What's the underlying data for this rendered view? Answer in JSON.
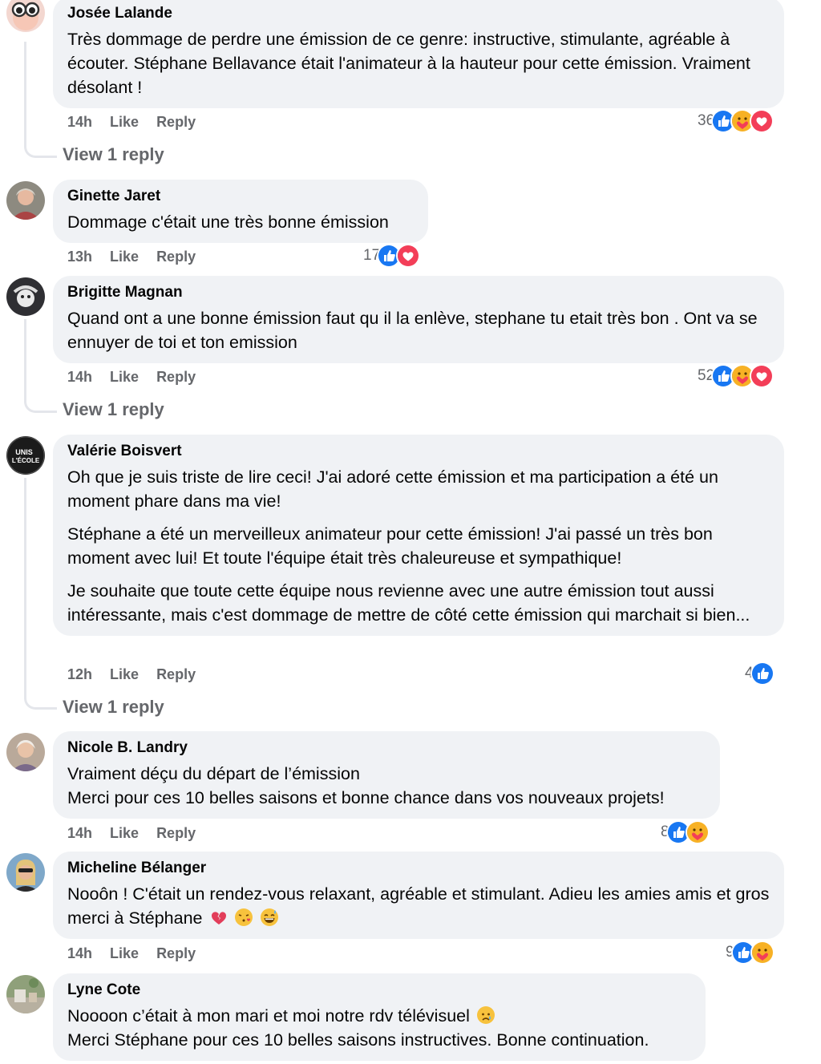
{
  "comments": [
    {
      "author": "Josée Lalande",
      "paragraphs": [
        "Très dommage de perdre une émission de ce genre: instructive, stimulante, agréable à écouter. Stéphane Bellavance était l'animateur à la hauteur pour cette émission. Vraiment désolant !"
      ],
      "time": "14h",
      "like": "Like",
      "reply": "Reply",
      "reaction_count": "36",
      "reactions": [
        "like-icon",
        "care-icon",
        "love-icon"
      ],
      "view_replies": "View 1 reply"
    },
    {
      "author": "Ginette Jaret",
      "paragraphs": [
        "Dommage c'était une très bonne émission"
      ],
      "time": "13h",
      "like": "Like",
      "reply": "Reply",
      "reaction_count": "17",
      "reactions": [
        "like-icon",
        "love-icon"
      ]
    },
    {
      "author": "Brigitte Magnan",
      "paragraphs": [
        "Quand ont a une bonne émission faut qu il la enlève, stephane tu etait très bon . Ont va se ennuyer de toi et ton emission"
      ],
      "time": "14h",
      "like": "Like",
      "reply": "Reply",
      "reaction_count": "52",
      "reactions": [
        "like-icon",
        "care-icon",
        "love-icon"
      ],
      "view_replies": "View 1 reply"
    },
    {
      "author": "Valérie Boisvert",
      "avatar_text": [
        "UNIS",
        "L'ÉCOLE"
      ],
      "paragraphs": [
        "Oh que je suis triste de lire ceci! J'ai adoré cette émission et ma participation a été un moment phare dans ma vie!",
        "Stéphane a été un merveilleux animateur pour cette émission! J'ai passé un très bon moment avec lui! Et toute l'équipe était très chaleureuse et sympathique!",
        "Je souhaite que toute cette équipe nous revienne avec une autre émission tout aussi intéressante, mais c'est dommage de mettre de côté cette émission qui marchait si bien..."
      ],
      "time": "12h",
      "like": "Like",
      "reply": "Reply",
      "reaction_count": "4",
      "reactions": [
        "like-icon"
      ],
      "view_replies": "View 1 reply"
    },
    {
      "author": "Nicole B. Landry",
      "paragraphs": [
        "Vraiment déçu du départ de l’émission",
        "Merci pour ces 10 belles saisons et bonne chance dans vos nouveaux projets!"
      ],
      "time": "14h",
      "like": "Like",
      "reply": "Reply",
      "reaction_count": "8",
      "reactions": [
        "like-icon",
        "care-icon"
      ]
    },
    {
      "author": "Micheline Bélanger",
      "paragraphs": [
        "Nooôn ! C'était un rendez-vous relaxant, agréable et stimulant. Adieu les amies amis et gros merci à Stéphane"
      ],
      "emojis": [
        "broken-heart-emoji",
        "kissing-face-emoji",
        "grinning-sweat-emoji"
      ],
      "time": "14h",
      "like": "Like",
      "reply": "Reply",
      "reaction_count": "9",
      "reactions": [
        "like-icon",
        "care-icon"
      ]
    },
    {
      "author": "Lyne Cote",
      "paragraphs": [
        "Noooon c’était à mon mari et moi notre rdv télévisuel",
        "Merci Stéphane pour ces 10 belles saisons instructives. Bonne continuation."
      ],
      "emojis": [
        "sad-relieved-face-emoji"
      ]
    }
  ],
  "colors": {
    "bubble": "#f0f2f5",
    "meta_text": "#65676b",
    "like_blue": "#1877f2",
    "love_red": "#f33e58",
    "care_yellow": "#f7b125"
  }
}
